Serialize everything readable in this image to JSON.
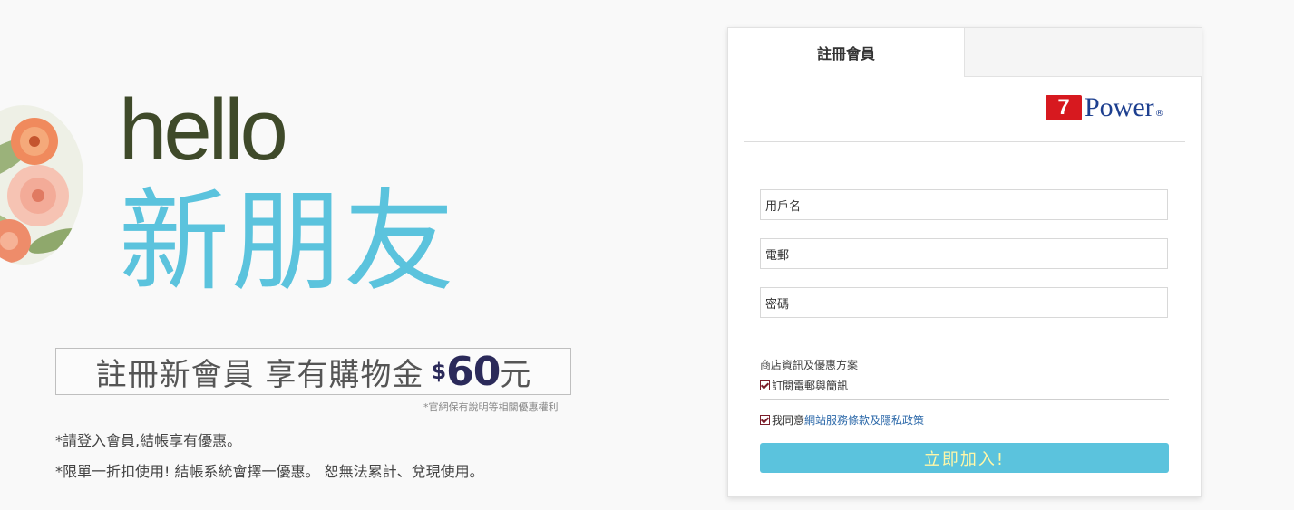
{
  "promo": {
    "hello": "hello",
    "new_friend": "新朋友",
    "offer_text": "註冊新會員 享有購物金",
    "offer_currency": "$",
    "offer_amount": "60",
    "offer_unit": "元",
    "rights_note": "*官網保有說明等相關優惠權利",
    "note_login": "*請登入會員,結帳享有優惠。",
    "note_limit": "*限單一折扣使用! 結帳系統會擇一優惠。 恕無法累計、兌現使用。"
  },
  "card": {
    "tab_register": "註冊會員",
    "brand_number": "7",
    "brand_word": "Power",
    "brand_reg": "®",
    "fields": {
      "username_placeholder": "用戶名",
      "email_placeholder": "電郵",
      "password_placeholder": "密碼"
    },
    "store_section_label": "商店資訊及優惠方案",
    "subscribe_label": "訂閱電郵與簡訊",
    "agree_prefix": "我同意",
    "agree_link": "網站服務條款及隱私政策",
    "join_button": "立即加入!"
  },
  "colors": {
    "accent": "#5bc3dd",
    "hello": "#3f4a2a",
    "brand_red": "#d7191f",
    "brand_blue": "#1d3f8f",
    "amount": "#2b2a5a",
    "button_text": "#fff7a8"
  }
}
